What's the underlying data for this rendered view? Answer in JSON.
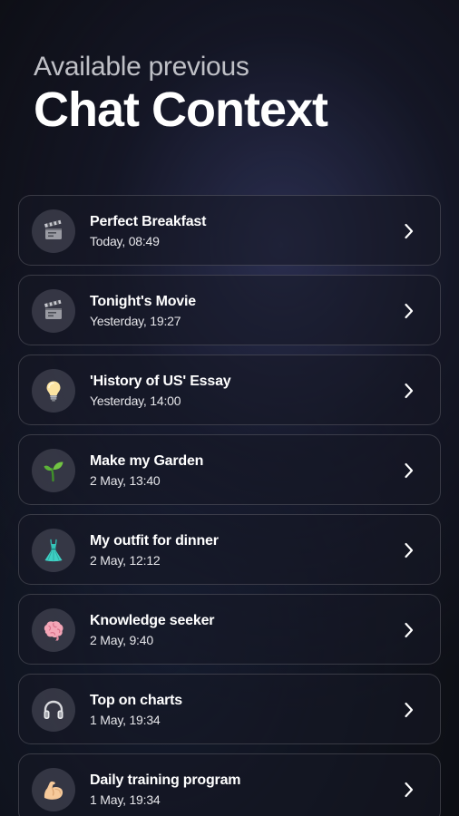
{
  "header": {
    "subtitle": "Available previous",
    "title": "Chat Context"
  },
  "chats": [
    {
      "icon": "clapperboard-icon",
      "title": "Perfect Breakfast",
      "time": "Today, 08:49"
    },
    {
      "icon": "clapperboard-icon",
      "title": "Tonight's Movie",
      "time": "Yesterday, 19:27"
    },
    {
      "icon": "lightbulb-icon",
      "title": "'History of US' Essay",
      "time": "Yesterday, 14:00"
    },
    {
      "icon": "seedling-icon",
      "title": "Make my Garden",
      "time": "2 May, 13:40"
    },
    {
      "icon": "dress-icon",
      "title": "My outfit for dinner",
      "time": "2 May, 12:12"
    },
    {
      "icon": "brain-icon",
      "title": "Knowledge seeker",
      "time": "2 May, 9:40"
    },
    {
      "icon": "headphones-icon",
      "title": "Top on charts",
      "time": "1 May, 19:34"
    },
    {
      "icon": "flexed-biceps-icon",
      "title": "Daily training program",
      "time": "1 May, 19:34"
    }
  ]
}
